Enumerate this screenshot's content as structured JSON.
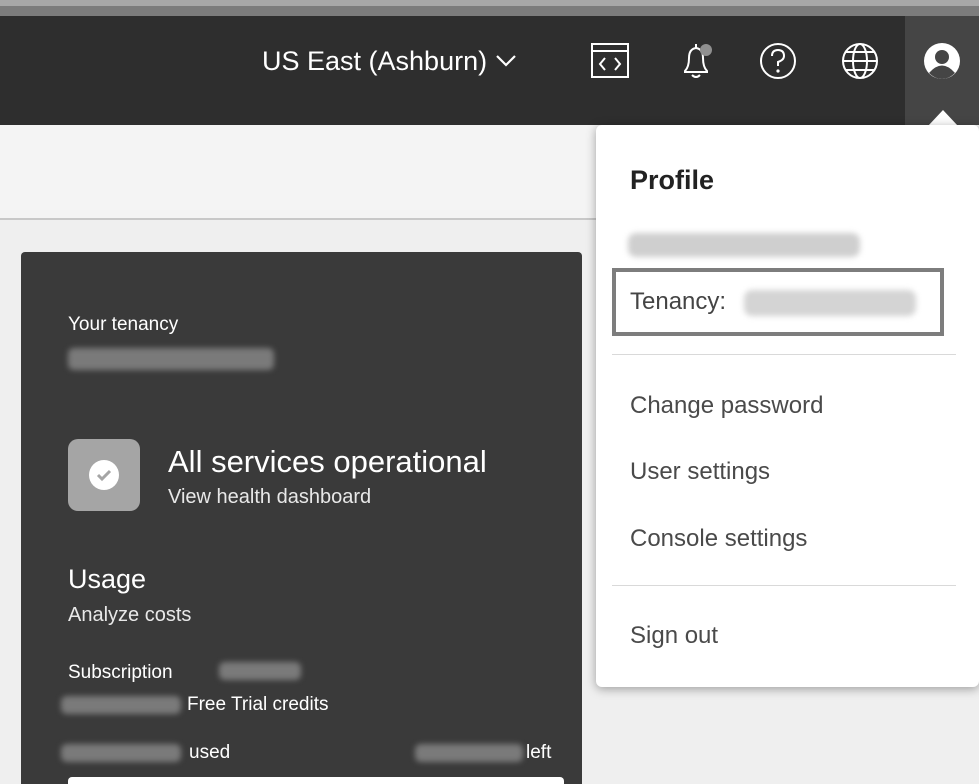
{
  "header": {
    "region_label": "US East (Ashburn)",
    "icons": [
      "developer-tools-icon",
      "notifications-bell-icon",
      "help-icon",
      "language-globe-icon",
      "profile-avatar-icon"
    ]
  },
  "tenancy_card": {
    "your_tenancy_label": "Your tenancy",
    "status_title": "All services operational",
    "status_link": "View health dashboard",
    "usage_title": "Usage",
    "usage_link": "Analyze costs",
    "subscription_label": "Subscription",
    "free_trial_label": "Free Trial credits",
    "used_label": "used",
    "left_label": "left"
  },
  "profile_menu": {
    "title": "Profile",
    "tenancy_label": "Tenancy:",
    "items": [
      "Change password",
      "User settings",
      "Console settings"
    ],
    "sign_out": "Sign out"
  },
  "colors": {
    "header_bg": "#2e2e2e",
    "card_bg": "#3a3a3a",
    "menu_bg": "#ffffff",
    "highlight_border": "#7d7d7d"
  }
}
